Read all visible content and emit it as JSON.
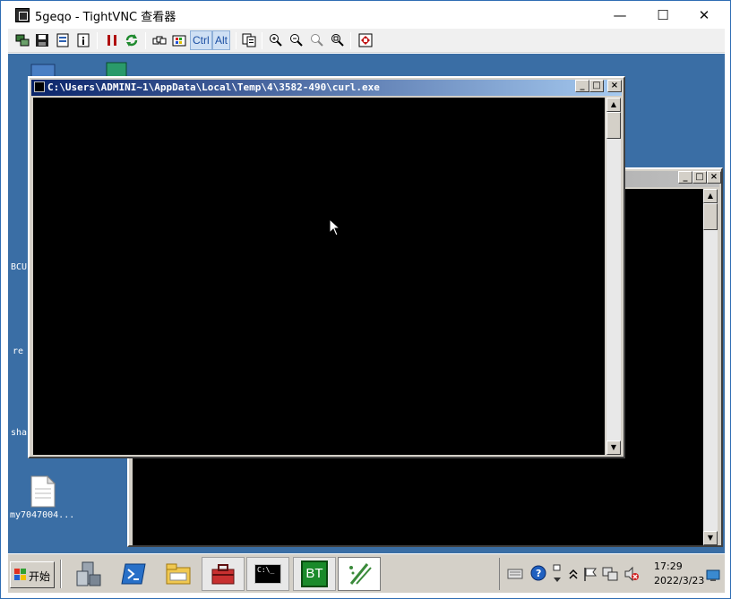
{
  "window": {
    "title": "5geqo - TightVNC 查看器",
    "minimize_glyph": "—",
    "maximize_glyph": "☐",
    "close_glyph": "✕"
  },
  "toolbar": {
    "ctrl_label": "Ctrl",
    "alt_label": "Alt",
    "icons": [
      "new-connection-icon",
      "save-icon",
      "options-icon",
      "info-icon",
      "pause-icon",
      "refresh-icon",
      "ctrl-alt-del-icon",
      "win-key-icon",
      "transfer-icon",
      "zoom-in-icon",
      "zoom-out-icon",
      "zoom-100-icon",
      "zoom-auto-icon",
      "fullscreen-icon"
    ]
  },
  "desktop": {
    "icons": [
      {
        "label": "BCU"
      },
      {
        "label": "re"
      },
      {
        "label": "sha"
      },
      {
        "label": "my7047004..."
      }
    ]
  },
  "console_front": {
    "title": "C:\\Users\\ADMINI~1\\AppData\\Local\\Temp\\4\\3582-490\\curl.exe"
  },
  "taskbar": {
    "start_label": "开始",
    "time": "17:29",
    "date": "2022/3/23",
    "items": [
      "server-manager-icon",
      "powershell-icon",
      "explorer-icon",
      "toolbox-icon",
      "cmd-icon",
      "bt-panel-icon",
      "notepad-plus-icon"
    ],
    "bt_label": "BT",
    "cmd_label": "C:\\_"
  }
}
